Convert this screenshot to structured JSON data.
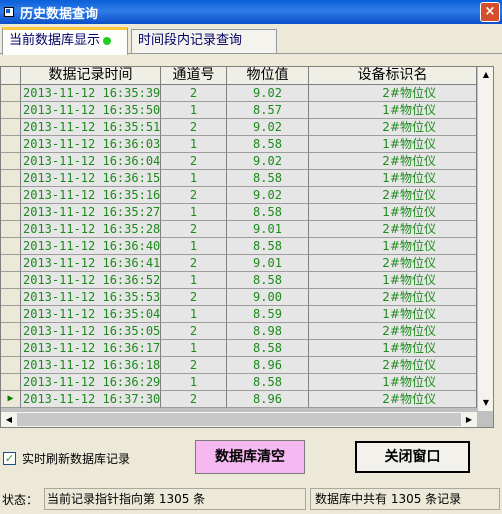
{
  "window": {
    "title": "历史数据查询",
    "close_label": "×"
  },
  "tabs": [
    {
      "label": "当前数据库显示"
    },
    {
      "label": "时间段内记录查询"
    }
  ],
  "grid": {
    "columns": [
      "",
      "数据记录时间",
      "通道号",
      "物位值",
      "设备标识名"
    ],
    "rows": [
      [
        "",
        "2013-11-12 16:35:39",
        "2",
        "9.02",
        "2#物位仪"
      ],
      [
        "",
        "2013-11-12 16:35:50",
        "1",
        "8.57",
        "1#物位仪"
      ],
      [
        "",
        "2013-11-12 16:35:51",
        "2",
        "9.02",
        "2#物位仪"
      ],
      [
        "",
        "2013-11-12 16:36:03",
        "1",
        "8.58",
        "1#物位仪"
      ],
      [
        "",
        "2013-11-12 16:36:04",
        "2",
        "9.02",
        "2#物位仪"
      ],
      [
        "",
        "2013-11-12 16:36:15",
        "1",
        "8.58",
        "1#物位仪"
      ],
      [
        "",
        "2013-11-12 16:35:16",
        "2",
        "9.02",
        "2#物位仪"
      ],
      [
        "",
        "2013-11-12 16:35:27",
        "1",
        "8.58",
        "1#物位仪"
      ],
      [
        "",
        "2013-11-12 16:35:28",
        "2",
        "9.01",
        "2#物位仪"
      ],
      [
        "",
        "2013-11-12 16:36:40",
        "1",
        "8.58",
        "1#物位仪"
      ],
      [
        "",
        "2013-11-12 16:36:41",
        "2",
        "9.01",
        "2#物位仪"
      ],
      [
        "",
        "2013-11-12 16:36:52",
        "1",
        "8.58",
        "1#物位仪"
      ],
      [
        "",
        "2013-11-12 16:35:53",
        "2",
        "9.00",
        "2#物位仪"
      ],
      [
        "",
        "2013-11-12 16:35:04",
        "1",
        "8.59",
        "1#物位仪"
      ],
      [
        "",
        "2013-11-12 16:35:05",
        "2",
        "8.98",
        "2#物位仪"
      ],
      [
        "",
        "2013-11-12 16:36:17",
        "1",
        "8.58",
        "1#物位仪"
      ],
      [
        "",
        "2013-11-12 16:36:18",
        "2",
        "8.96",
        "2#物位仪"
      ],
      [
        "",
        "2013-11-12 16:36:29",
        "1",
        "8.58",
        "1#物位仪"
      ],
      [
        "▶",
        "2013-11-12 16:37:30",
        "2",
        "8.96",
        "2#物位仪"
      ]
    ]
  },
  "scrollbar": {
    "up": "▲",
    "down": "▼",
    "left": "◀",
    "right": "▶"
  },
  "controls": {
    "realtime_label": "实时刷新数据库记录",
    "realtime_checked": true,
    "check_mark": "✓",
    "clear_button": "数据库清空",
    "close_button": "关闭窗口"
  },
  "status": {
    "label": "状态：",
    "pointer_text": "当前记录指针指向第 1305 条",
    "total_text": "数据库中共有 1305 条记录"
  }
}
